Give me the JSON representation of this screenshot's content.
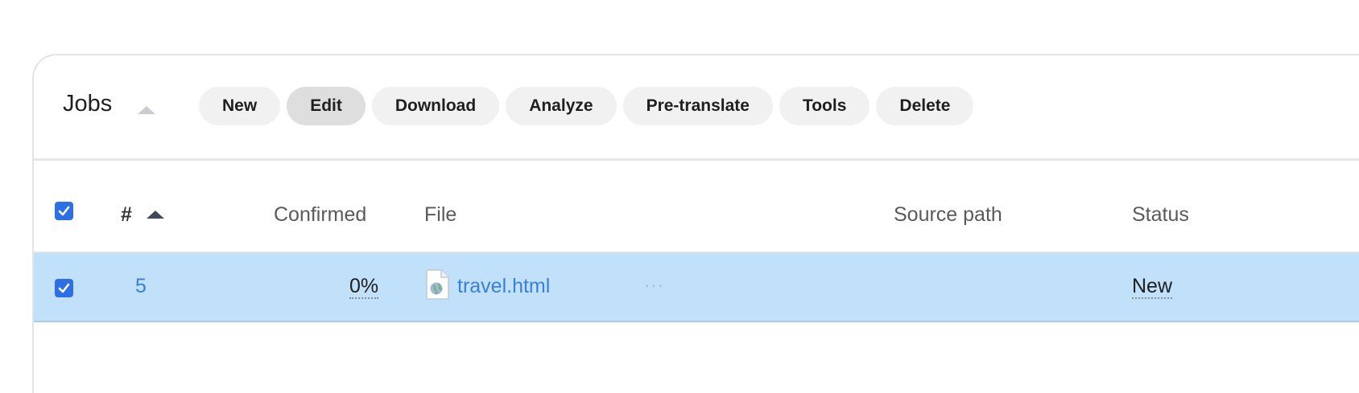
{
  "jobs_panel": {
    "title": "Jobs",
    "toolbar": {
      "new": "New",
      "edit": "Edit",
      "download": "Download",
      "analyze": "Analyze",
      "pretranslate": "Pre-translate",
      "tools": "Tools",
      "delete": "Delete"
    },
    "columns": {
      "number": "#",
      "confirmed": "Confirmed",
      "file": "File",
      "source_path": "Source path",
      "status": "Status"
    },
    "rows": [
      {
        "selected": true,
        "number": "5",
        "confirmed": "0%",
        "file": "travel.html",
        "more": "···",
        "source_path": "",
        "status": "New"
      }
    ]
  },
  "colors": {
    "accent": "#2f6fe4",
    "link": "#3a80d8",
    "selected_row": "#c1e0f9"
  },
  "icons": [
    "sort-asc-icon",
    "checkbox-checked-icon",
    "html-file-icon",
    "more-icon"
  ]
}
